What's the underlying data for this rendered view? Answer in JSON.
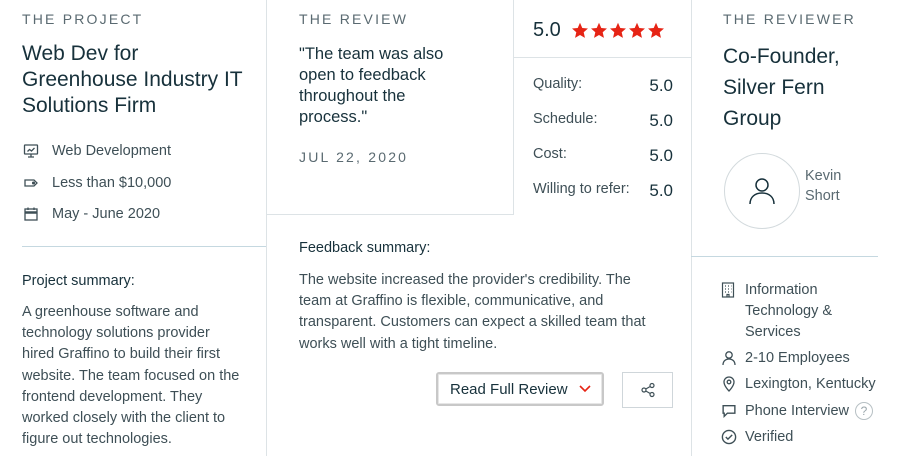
{
  "project": {
    "eyebrow": "THE PROJECT",
    "title_lines": [
      "Web Dev for",
      "Greenhouse Industry IT",
      "Solutions Firm"
    ],
    "meta": [
      {
        "icon": "monitor-icon",
        "label": "Web Development"
      },
      {
        "icon": "price-tag-icon",
        "label": "Less than $10,000"
      },
      {
        "icon": "calendar-icon",
        "label": "May - June 2020"
      }
    ],
    "summary_heading": "Project summary:",
    "summary_lines": [
      "A greenhouse software and",
      "technology solutions provider",
      "hired Graffino to build their first",
      "website. The team focused on the",
      "frontend development. They",
      "worked closely with the client to",
      "figure out technologies."
    ]
  },
  "review": {
    "eyebrow": "THE REVIEW",
    "quote_lines": [
      "\"The team was also",
      "open to feedback",
      "throughout the",
      "process.\""
    ],
    "date": "JUL 22, 2020",
    "overall": "5.0",
    "stars": 5,
    "star_color": "#e62415",
    "ratings": [
      {
        "label": "Quality:",
        "value": "5.0"
      },
      {
        "label": "Schedule:",
        "value": "5.0"
      },
      {
        "label": "Cost:",
        "value": "5.0"
      },
      {
        "label": "Willing to refer:",
        "value": "5.0"
      }
    ],
    "feedback_heading": "Feedback summary:",
    "feedback_lines": [
      "The website increased the provider's credibility. The",
      "team at Graffino is flexible, communicative, and",
      "transparent. Customers can expect a skilled team that",
      "works well with a tight timeline."
    ],
    "read_full_label": "Read Full Review",
    "chevron_color": "#e62415"
  },
  "reviewer": {
    "eyebrow": "THE REVIEWER",
    "title_lines": [
      "Co-Founder,",
      "Silver Fern",
      "Group"
    ],
    "name_lines": [
      "Kevin",
      "Short"
    ],
    "meta": [
      {
        "icon": "building-icon",
        "lines": [
          "Information",
          "Technology &",
          "Services"
        ]
      },
      {
        "icon": "person-icon",
        "lines": [
          "2-10 Employees"
        ]
      },
      {
        "icon": "location-pin-icon",
        "lines": [
          "Lexington, Kentucky"
        ]
      },
      {
        "icon": "chat-bubble-icon",
        "lines": [
          "Phone Interview"
        ]
      },
      {
        "icon": "verified-check-icon",
        "lines": [
          "Verified"
        ]
      }
    ],
    "help_mark": "?"
  }
}
